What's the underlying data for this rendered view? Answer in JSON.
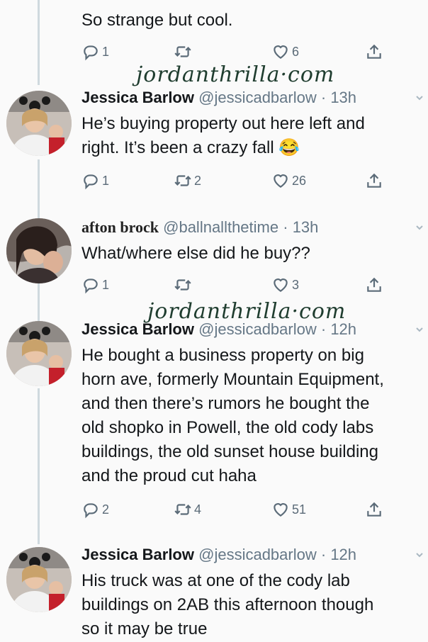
{
  "watermark": "jordanthrilla·com",
  "top_tweet": {
    "text": "So strange but cool.",
    "reply_count": "1",
    "retweet_count": "",
    "like_count": "6"
  },
  "tweets": [
    {
      "name": "Jessica Barlow",
      "handle": "@jessicadbarlow",
      "time": "13h",
      "lines": [
        "He’s buying property out here left and",
        "right. It’s been a crazy fall 😂"
      ],
      "reply_count": "1",
      "retweet_count": "2",
      "like_count": "26"
    },
    {
      "name": "afton brock",
      "handle": "@ballnallthetime",
      "time": "13h",
      "lines": [
        "What/where else did he buy??"
      ],
      "reply_count": "1",
      "retweet_count": "",
      "like_count": "3"
    },
    {
      "name": "Jessica Barlow",
      "handle": "@jessicadbarlow",
      "time": "12h",
      "lines": [
        "He bought a business property on big",
        "horn ave, formerly Mountain Equipment,",
        "and then there’s rumors he bought the",
        "old shopko in Powell, the old cody labs",
        "buildings, the old sunset house building",
        "and the proud cut haha"
      ],
      "reply_count": "2",
      "retweet_count": "4",
      "like_count": "51"
    },
    {
      "name": "Jessica Barlow",
      "handle": "@jessicadbarlow",
      "time": "12h",
      "lines": [
        "His truck was at one of the cody lab",
        "buildings on 2AB this afternoon though",
        "so it may be true"
      ]
    }
  ],
  "separator": "·"
}
